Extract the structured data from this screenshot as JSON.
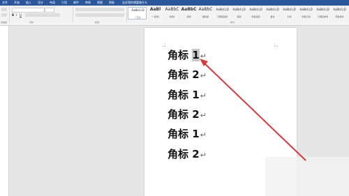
{
  "ribbon": {
    "tabs": [
      "文件",
      "开始",
      "插入",
      "设计",
      "布局",
      "引用",
      "邮件",
      "审阅",
      "视图",
      "帮助",
      "告诉我你想要做什么"
    ],
    "groups": {
      "clipboard": "剪贴板",
      "font": "字体",
      "paragraph": "段落",
      "styles": "样式"
    },
    "style_items": [
      {
        "preview": "AaBbCcD",
        "name": "↵正文"
      },
      {
        "preview": "AaBl",
        "name": "一 标题1"
      },
      {
        "preview": "AaBbC",
        "name": "标题2"
      },
      {
        "preview": "AaBbC",
        "name": "标题"
      },
      {
        "preview": "AaBbC",
        "name": "副标题"
      },
      {
        "preview": "AaBbCcD",
        "name": "不明显强调"
      },
      {
        "preview": "AaBbCcD",
        "name": "强调"
      },
      {
        "preview": "AaBbCcD",
        "name": "明显强调"
      },
      {
        "preview": "AaBbCcD",
        "name": "要点"
      },
      {
        "preview": "AaBbCcD",
        "name": "引用"
      },
      {
        "preview": "AaBbCcD",
        "name": "明显引用"
      },
      {
        "preview": "AaBbCcD",
        "name": "不明显参考"
      },
      {
        "preview": "AaBbCcD",
        "name": "明显参考"
      }
    ]
  },
  "document": {
    "lines": [
      {
        "text": "角标 ",
        "num": "1"
      },
      {
        "text": "角标 2",
        "num": ""
      },
      {
        "text": "角标 1",
        "num": ""
      },
      {
        "text": "角标 2",
        "num": ""
      },
      {
        "text": "角标 1",
        "num": ""
      },
      {
        "text": "角标 2",
        "num": ""
      }
    ],
    "return_mark": "↵"
  },
  "colors": {
    "ribbon_bar": "#2b579a",
    "arrow": "#d9383a"
  }
}
